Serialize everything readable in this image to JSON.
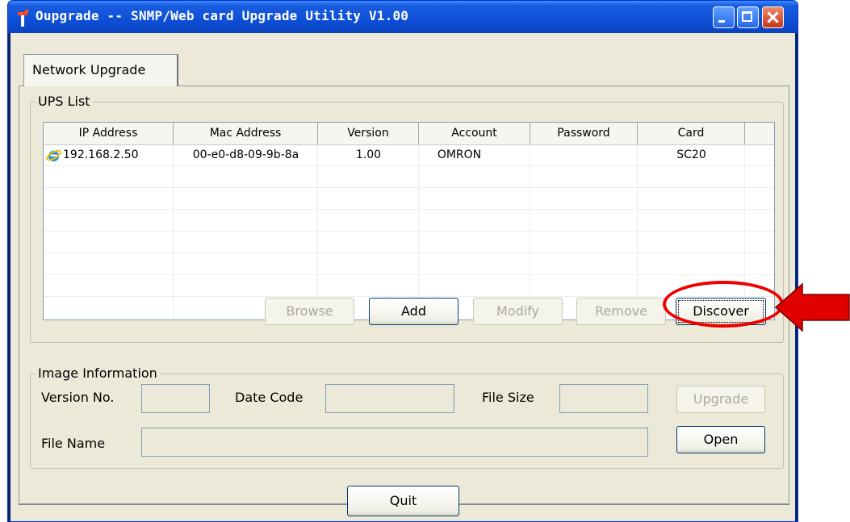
{
  "window": {
    "title": "Oupgrade -- SNMP/Web card Upgrade Utility V1.00"
  },
  "tabs": [
    {
      "label": "Network Upgrade"
    }
  ],
  "ups_list": {
    "group_label": "UPS List",
    "columns": [
      "IP Address",
      "Mac Address",
      "Version",
      "Account",
      "Password",
      "Card"
    ],
    "rows": [
      {
        "ip": "192.168.2.50",
        "mac": "00-e0-d8-09-9b-8a",
        "version": "1.00",
        "account": "OMRON",
        "password": "",
        "card": "SC20",
        "icon": "internet-explorer-icon"
      }
    ],
    "buttons": {
      "browse": "Browse",
      "add": "Add",
      "modify": "Modify",
      "remove": "Remove",
      "discover": "Discover"
    }
  },
  "image_info": {
    "group_label": "Image Information",
    "version_label": "Version No.",
    "version_value": "",
    "date_label": "Date Code",
    "date_value": "",
    "size_label": "File Size",
    "size_value": "",
    "filename_label": "File Name",
    "filename_value": "",
    "upgrade_label": "Upgrade",
    "open_label": "Open"
  },
  "quit_label": "Quit",
  "annotation": {
    "highlight_color": "#ee0000",
    "arrow_color": "#e00000"
  }
}
